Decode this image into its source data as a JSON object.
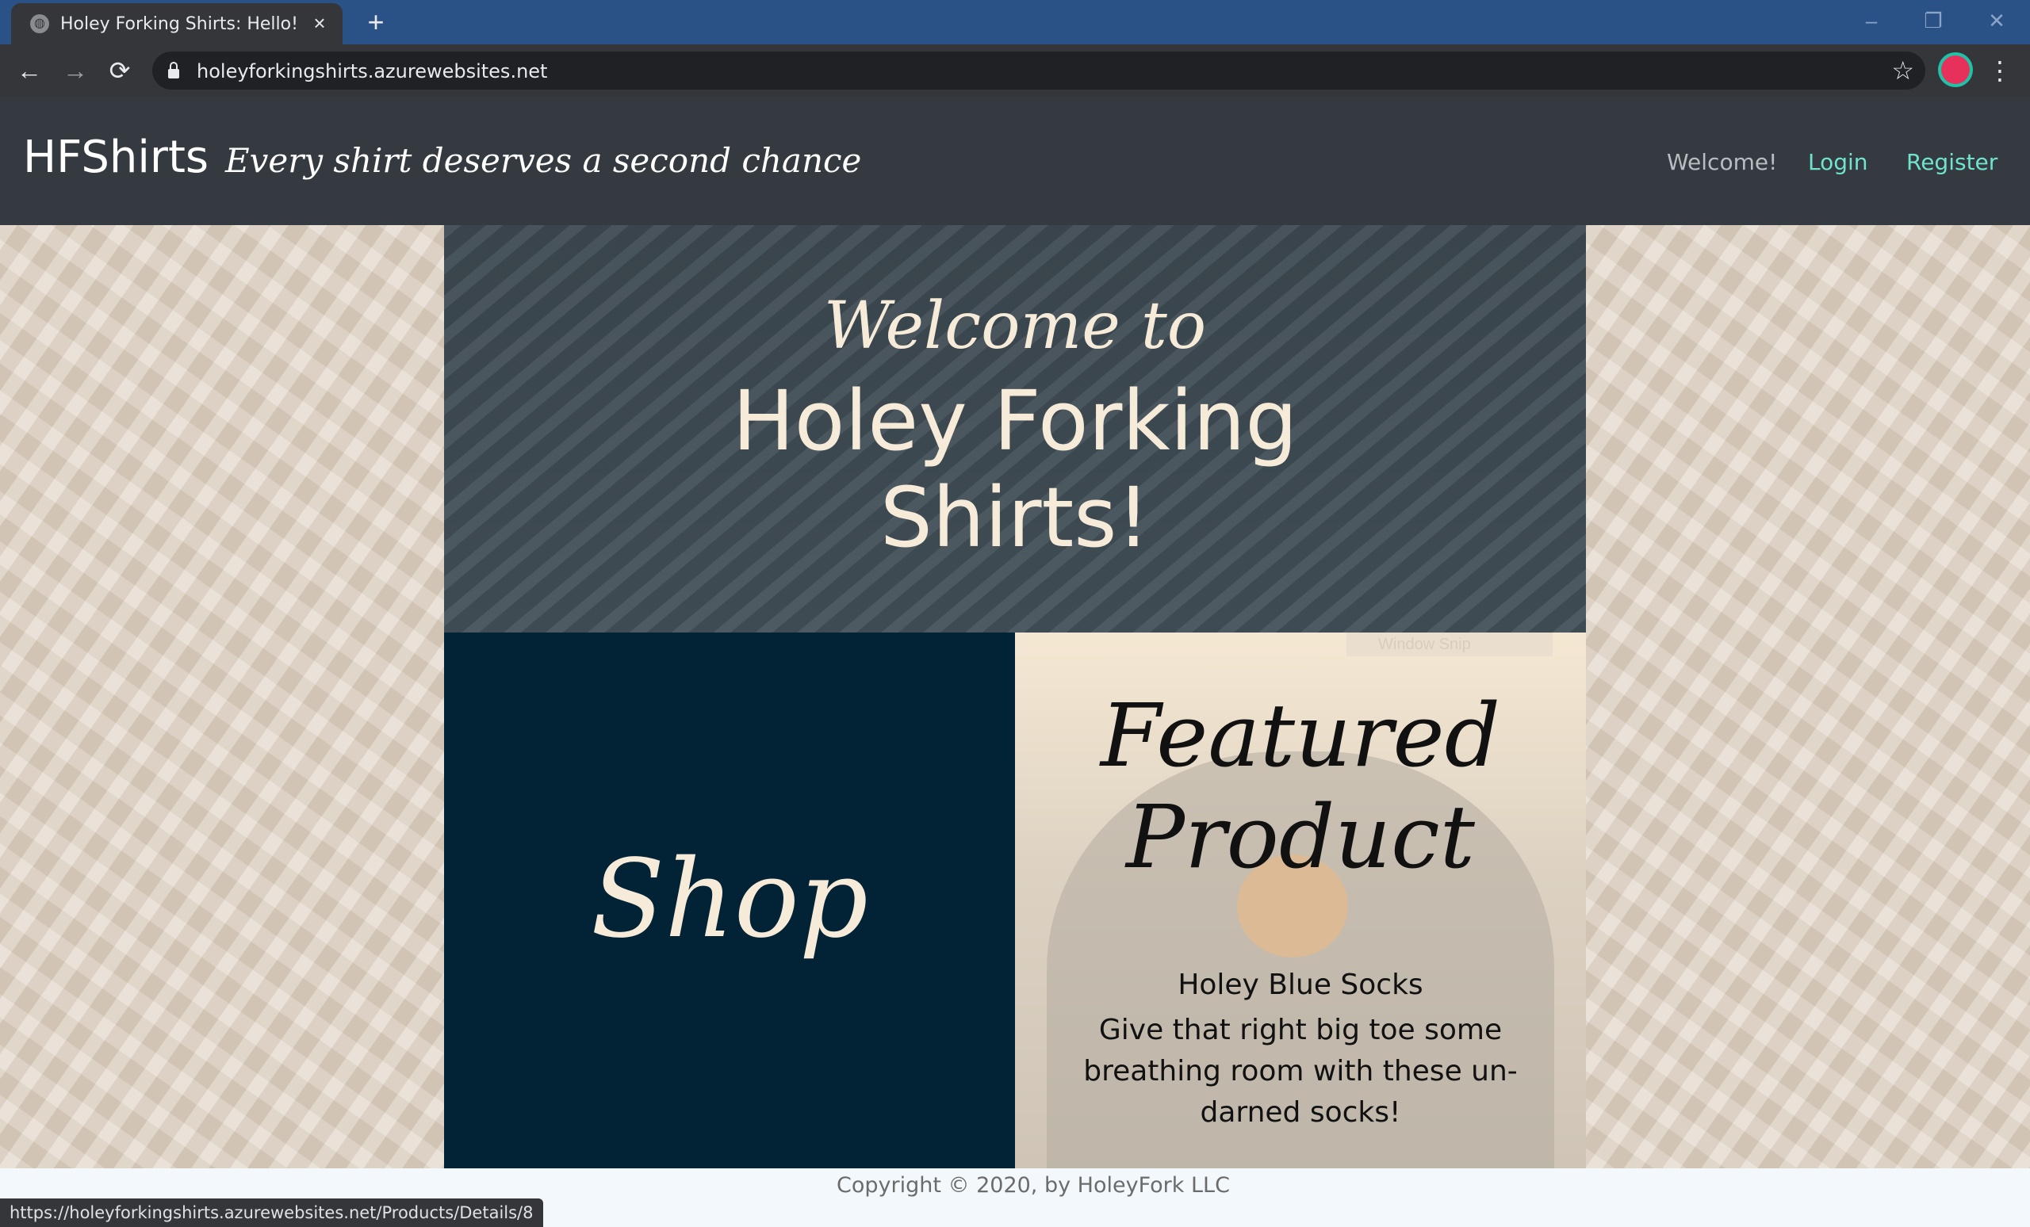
{
  "browser": {
    "tab_title": "Holey Forking Shirts: Hello!",
    "tab_close_icon": "×",
    "new_tab_icon": "+",
    "url": "holeyforkingshirts.azurewebsites.net",
    "status_url": "https://holeyforkingshirts.azurewebsites.net/Products/Details/8",
    "icons": {
      "back": "←",
      "forward": "→",
      "reload": "⟳",
      "star": "☆",
      "menu": "⋮",
      "minimize": "–",
      "restore": "❐",
      "close": "✕"
    }
  },
  "site": {
    "brand": "HFShirts",
    "tagline": "Every shirt deserves a second chance",
    "nav": {
      "welcome": "Welcome!",
      "login": "Login",
      "register": "Register"
    },
    "hero": {
      "welcome": "Welcome to",
      "title_line1": "Holey Forking",
      "title_line2": "Shirts!"
    },
    "shop": {
      "label": "Shop"
    },
    "featured": {
      "heading_line1": "Featured",
      "heading_line2": "Product",
      "product_name": "Holey Blue Socks",
      "description": "Give that right big toe some breathing room with these un-darned socks!",
      "overlay_text": "Window Snip"
    },
    "footer": {
      "copyright": "Copyright © 2020, by HoleyFork LLC"
    }
  },
  "colors": {
    "header_bg": "#343a40",
    "nav_accent": "#6fe3cc",
    "shop_bg": "#022236",
    "hero_text": "#f6ead8"
  }
}
